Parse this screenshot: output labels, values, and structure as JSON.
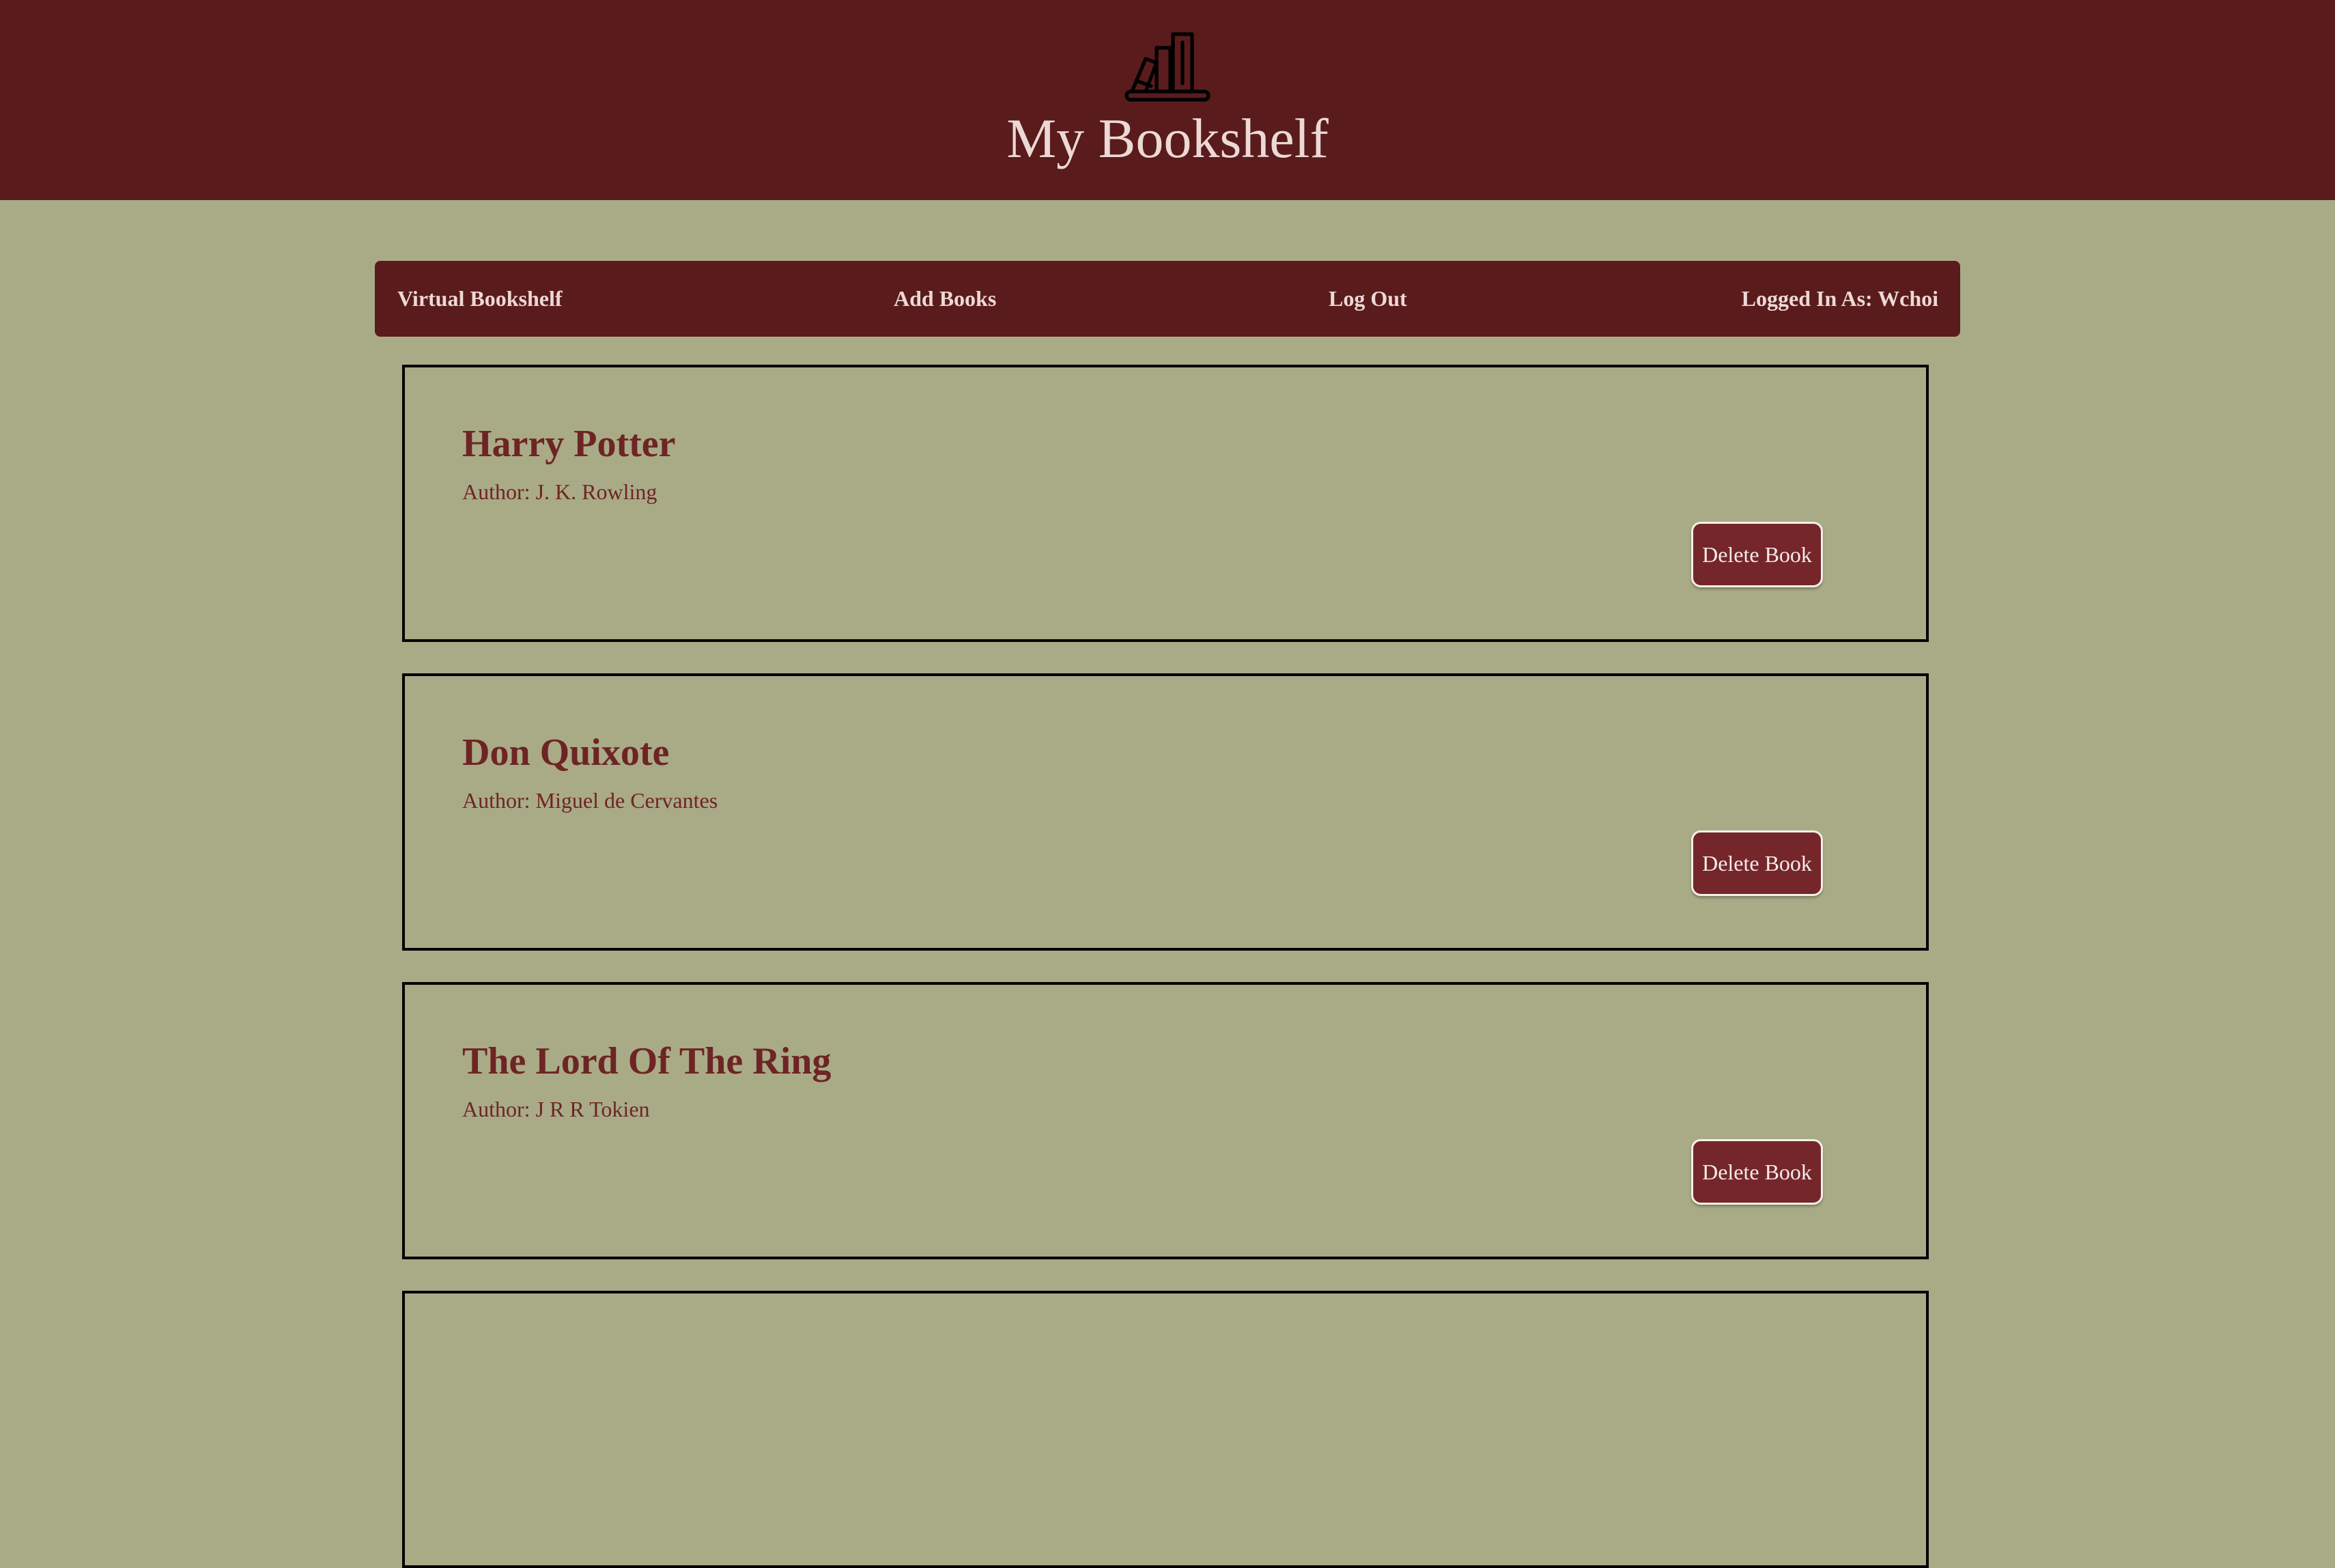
{
  "header": {
    "logo_icon": "bookshelf-icon",
    "title": "My Bookshelf"
  },
  "nav": {
    "home": "Virtual Bookshelf",
    "add": "Add Books",
    "logout": "Log Out",
    "user": "Logged In As: Wchoi"
  },
  "books": [
    {
      "title": "Harry Potter",
      "author_prefix": "Author:",
      "author": "J. K. Rowling",
      "delete_label": "Delete Book"
    },
    {
      "title": "Don Quixote",
      "author_prefix": "Author:",
      "author": "Miguel de Cervantes",
      "delete_label": "Delete Book"
    },
    {
      "title": "The Lord Of The Ring",
      "author_prefix": "Author:",
      "author": "J R R Tokien",
      "delete_label": "Delete Book"
    }
  ],
  "colors": {
    "page_background": "#a9ab86",
    "header_background": "#5a1b1c",
    "accent_text": "#6e2425",
    "button_background": "#75262a"
  }
}
